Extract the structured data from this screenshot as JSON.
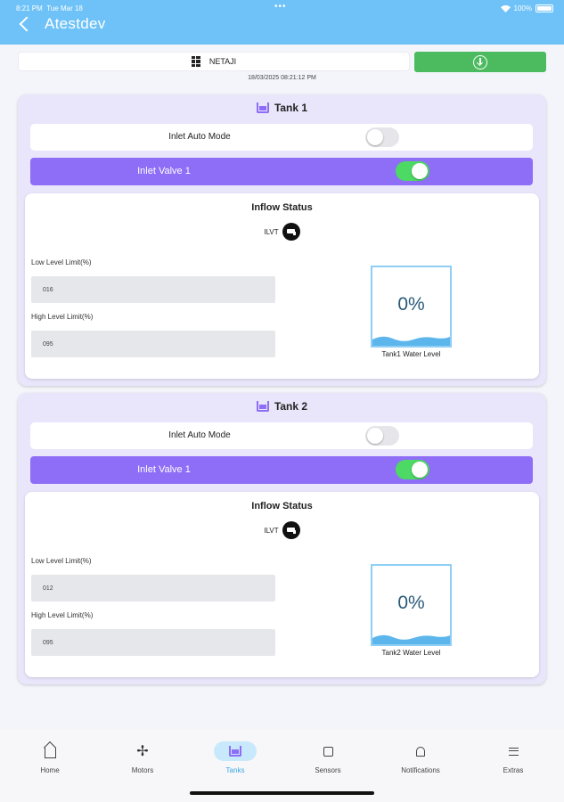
{
  "status_bar": {
    "time": "8:21 PM",
    "date": "Tue Mar 18",
    "dots": "•••",
    "battery": "100%"
  },
  "header": {
    "title": "Atestdev"
  },
  "site": {
    "name": "NETAJI",
    "timestamp": "18/03/2025 08:21:12 PM"
  },
  "tanks": [
    {
      "title": "Tank 1",
      "auto_mode_label": "Inlet Auto Mode",
      "auto_mode_on": false,
      "valve_label": "Inlet Valve 1",
      "valve_on": true,
      "inflow_title": "Inflow Status",
      "inflow_code": "ILVT",
      "low_label": "Low Level Limit(%)",
      "low_value": "016",
      "high_label": "High Level Limit(%)",
      "high_value": "095",
      "level_percent": "0%",
      "level_caption": "Tank1 Water Level"
    },
    {
      "title": "Tank 2",
      "auto_mode_label": "Inlet Auto Mode",
      "auto_mode_on": false,
      "valve_label": "Inlet Valve 1",
      "valve_on": true,
      "inflow_title": "Inflow Status",
      "inflow_code": "ILVT",
      "low_label": "Low Level Limit(%)",
      "low_value": "012",
      "high_label": "High Level Limit(%)",
      "high_value": "095",
      "level_percent": "0%",
      "level_caption": "Tank2 Water Level"
    }
  ],
  "nav": {
    "items": [
      {
        "label": "Home",
        "icon": "home-icon"
      },
      {
        "label": "Motors",
        "icon": "fan-icon"
      },
      {
        "label": "Tanks",
        "icon": "tank-icon",
        "active": true
      },
      {
        "label": "Sensors",
        "icon": "chip-icon"
      },
      {
        "label": "Notifications",
        "icon": "bell-icon"
      },
      {
        "label": "Extras",
        "icon": "menu-icon"
      }
    ]
  },
  "colors": {
    "header_bg": "#6ec2f7",
    "accent_purple": "#8e6ef7",
    "toggle_on": "#4cd964",
    "download_button": "#4cbb5f",
    "active_nav": "#3aa5e6"
  }
}
